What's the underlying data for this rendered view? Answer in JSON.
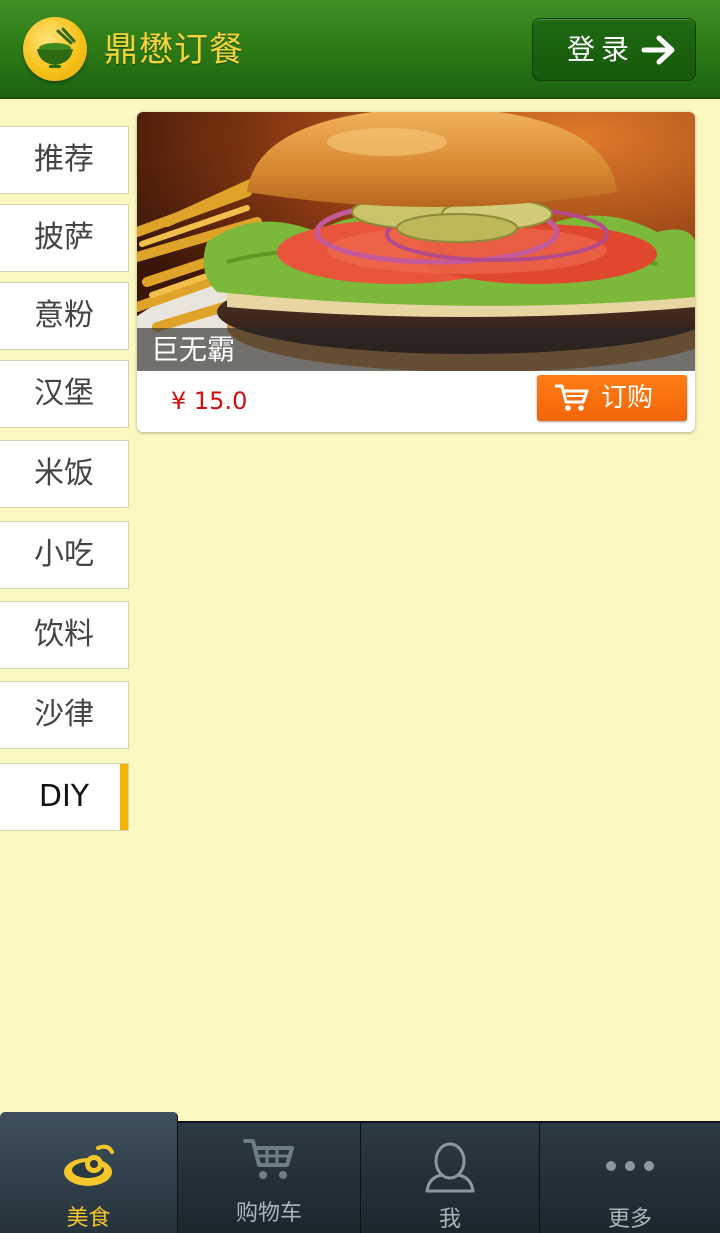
{
  "header": {
    "app_title": "鼎懋订餐",
    "login_label": "登录"
  },
  "categories": [
    {
      "label": "推荐",
      "selected": false
    },
    {
      "label": "披萨",
      "selected": false
    },
    {
      "label": "意粉",
      "selected": false
    },
    {
      "label": "汉堡",
      "selected": false
    },
    {
      "label": "米饭",
      "selected": false
    },
    {
      "label": "小吃",
      "selected": false
    },
    {
      "label": "饮料",
      "selected": false
    },
    {
      "label": "沙律",
      "selected": false
    },
    {
      "label": "DIY",
      "selected": true
    }
  ],
  "product": {
    "name": "巨无霸",
    "price": "¥ 15.0",
    "order_label": "订购"
  },
  "tabbar": {
    "tabs": [
      {
        "label": "美食",
        "icon": "food-icon",
        "active": true
      },
      {
        "label": "购物车",
        "icon": "cart-icon",
        "active": false
      },
      {
        "label": "我",
        "icon": "user-icon",
        "active": false
      },
      {
        "label": "更多",
        "icon": "more-icon",
        "active": false
      }
    ]
  },
  "colors": {
    "header_green": "#2d7a16",
    "title_yellow": "#f2d33a",
    "background": "#fcf8c2",
    "accent": "#f4b400",
    "order_orange": "#f2650a",
    "price_red": "#d10f0f"
  }
}
